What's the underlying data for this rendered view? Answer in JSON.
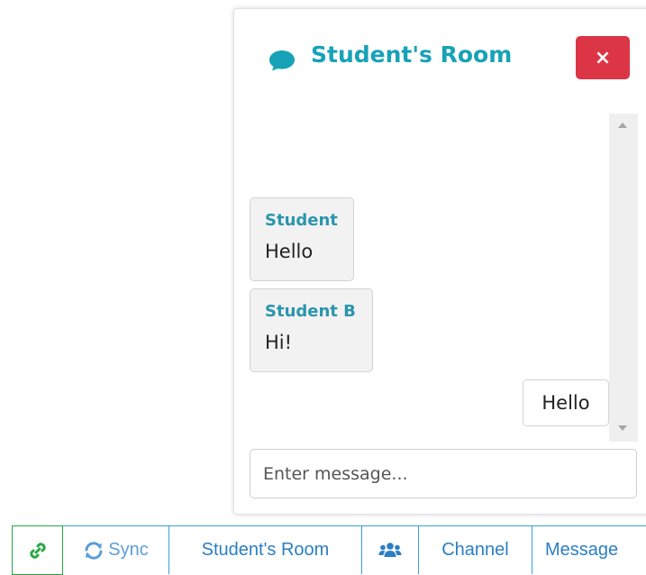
{
  "chat": {
    "title": "Student's Room",
    "title_icon": "comment-icon",
    "close_label": "×",
    "messages": [
      {
        "author": "Student",
        "text": "Hello"
      },
      {
        "author": "Student B",
        "text": "Hi!"
      }
    ],
    "own_messages": [
      {
        "text": "Hello"
      }
    ],
    "input": {
      "value": "",
      "placeholder": "Enter message..."
    }
  },
  "toolbar": {
    "link_icon": "link-icon",
    "sync_label": "Sync",
    "sync_icon": "sync-icon",
    "room_label": "Student's Room",
    "users_icon": "users-icon",
    "channel_label": "Channel",
    "message_label": "Message"
  },
  "colors": {
    "accent": "#17a2b8",
    "close": "#dc3545",
    "link_border": "#28a745",
    "toolbar_border": "#3a9fd9"
  }
}
